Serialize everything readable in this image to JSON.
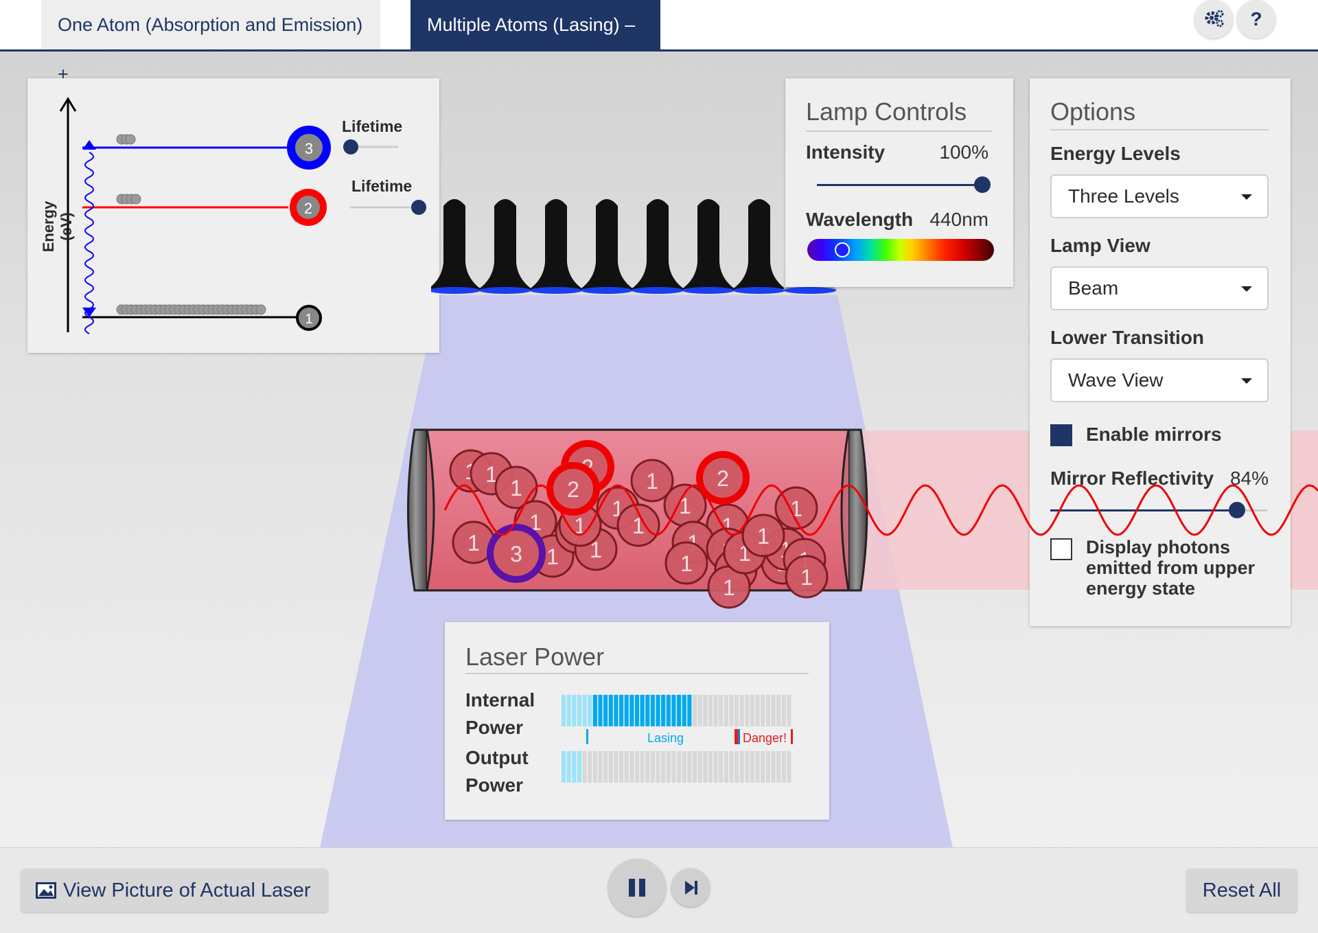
{
  "tabs": [
    {
      "label": "One Atom (Absorption and Emission) +"
    },
    {
      "label": "Multiple Atoms (Lasing) –"
    }
  ],
  "header": {
    "settings_icon": "gear-icon",
    "help_label": "?"
  },
  "energy_diagram": {
    "axis_label": "Energy (eV)",
    "lifetime_label_1": "Lifetime",
    "lifetime_label_2": "Lifetime",
    "level_3_label": "3",
    "level_2_label": "2",
    "level_1_label": "1",
    "level_3_color": "#0000ff",
    "level_2_color": "#ff0000",
    "level_1_color": "#000000"
  },
  "lamp_controls": {
    "title": "Lamp Controls",
    "intensity_label": "Intensity",
    "intensity_value": "100%",
    "wavelength_label": "Wavelength",
    "wavelength_value": "440nm"
  },
  "options": {
    "title": "Options",
    "energy_levels_label": "Energy Levels",
    "energy_levels_value": "Three Levels",
    "lamp_view_label": "Lamp View",
    "lamp_view_value": "Beam",
    "lower_transition_label": "Lower Transition",
    "lower_transition_value": "Wave View",
    "enable_mirrors_label": "Enable mirrors",
    "enable_mirrors_checked": true,
    "mirror_reflectivity_label": "Mirror Reflectivity",
    "mirror_reflectivity_value": "84%",
    "display_photons_label_1": "Display photons",
    "display_photons_label_2": "emitted from upper",
    "display_photons_label_3": "energy state",
    "display_photons_checked": false
  },
  "laser_power": {
    "title": "Laser Power",
    "internal_label_1": "Internal",
    "internal_label_2": "Power",
    "output_label_1": "Output",
    "output_label_2": "Power",
    "lasing_label": "Lasing",
    "danger_label": "Danger!",
    "internal_fraction": 0.57,
    "output_fraction": 0.09
  },
  "tube_atoms": {
    "atom_1_label": "1",
    "atom_2_label": "2",
    "atom_3_label": "3"
  },
  "bottom": {
    "view_picture_label": "View Picture of Actual Laser",
    "reset_label": "Reset All",
    "image_icon": "image-icon",
    "pause_icon": "pause-icon",
    "step_icon": "step-forward-icon"
  },
  "colors": {
    "accent": "#1e3566",
    "beam": "#c8c8f0",
    "laser": "#f4c8cc",
    "power": "#00aaee"
  }
}
